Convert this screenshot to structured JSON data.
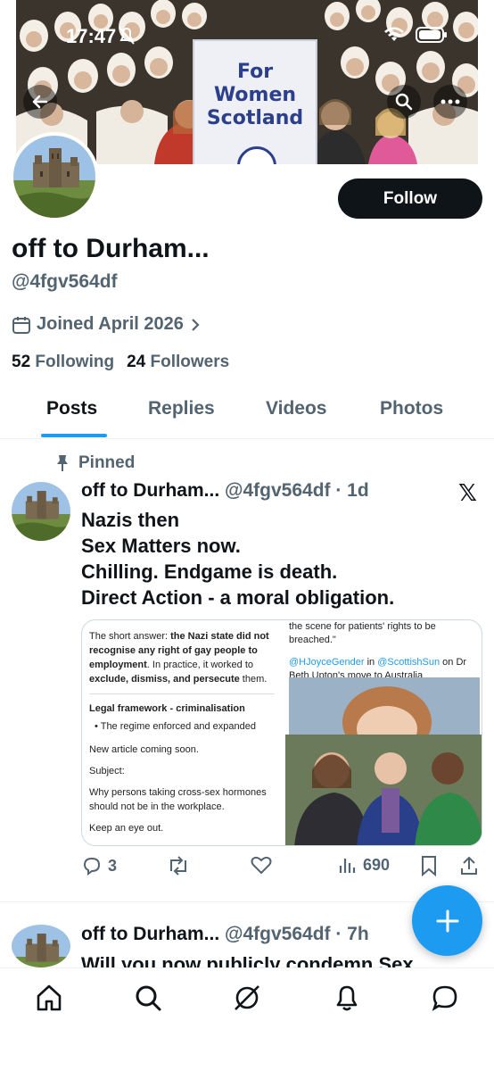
{
  "status_bar": {
    "time": "17:47"
  },
  "banner": {
    "sign_lines": [
      "For",
      "Women",
      "Scotland"
    ]
  },
  "profile": {
    "display_name": "off to Durham...",
    "handle": "@4fgv564df",
    "joined": "Joined April 2026",
    "following_count": "52",
    "following_label": "Following",
    "followers_count": "24",
    "followers_label": "Followers",
    "follow_label": "Follow"
  },
  "tabs": [
    {
      "label": "Posts",
      "active": true
    },
    {
      "label": "Replies",
      "active": false
    },
    {
      "label": "Videos",
      "active": false
    },
    {
      "label": "Photos",
      "active": false
    }
  ],
  "pinned_post": {
    "pinned_label": "Pinned",
    "author": "off to Durham...",
    "meta": "@4fgv564df · 1d",
    "lines": [
      "Nazis then",
      "Sex Matters now.",
      "Chilling. Endgame is death.",
      "Direct Action - a moral obligation."
    ],
    "media_left": {
      "p1_plain": "The short answer: ",
      "p1_bold": "the Nazi state did not recognise any right of gay people to employment",
      "p1_plain2": ". In practice, it worked to ",
      "p1_bold2": "exclude, dismiss, and persecute",
      "p1_plain3": " them.",
      "heading": "Legal framework - criminalisation",
      "bullet": "The regime enforced and expanded",
      "line_a": "New article coming soon.",
      "line_b": "Subject:",
      "line_c": "Why persons taking cross-sex hormones should not be in the workplace.",
      "line_d": "Keep an eye out."
    },
    "media_right": {
      "quote": "the scene for patients' rights to be breached.\"",
      "mention1": "@HJoyceGender",
      "in_word": " in ",
      "mention2": "@ScottishSun",
      "rest": " on Dr Beth Upton's move to Australia"
    },
    "replies": "3",
    "views": "690"
  },
  "second_post": {
    "author": "off to Durham...",
    "meta": "@4fgv564df · 7h",
    "text": "Will you now publicly condemn Sex"
  },
  "colors": {
    "accent": "#1d9bf0",
    "text": "#0f1419",
    "muted": "#536471"
  }
}
